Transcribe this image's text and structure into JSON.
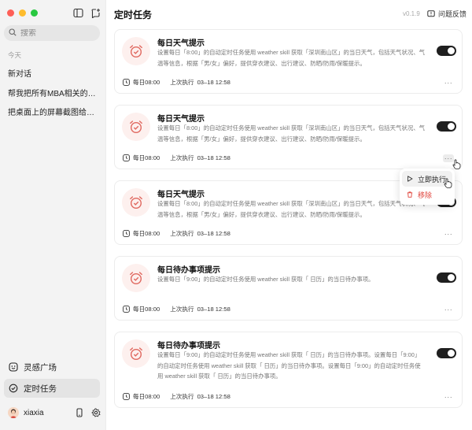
{
  "sidebar": {
    "search": {
      "placeholder": "搜索"
    },
    "section_today": "今天",
    "chats": [
      "新对话",
      "帮我把所有MBA相关的广告…",
      "把桌面上的屏幕截图给我整…"
    ],
    "nav": {
      "inspire": "灵感广场",
      "tasks": "定时任务"
    },
    "user": {
      "name": "xiaxia"
    }
  },
  "header": {
    "title": "定时任务",
    "version": "v0.1.9",
    "feedback": "问题反馈"
  },
  "tasks": [
    {
      "title": "每日天气提示",
      "desc": "设置每日「8:00」的自动定时任务使用 weather skill 获取「深圳南山区」的当日天气，包括天气状况、气温等信息，根据「男/女」偏好，提供穿衣建议、出行建议、防晒/防雨/保暖提示。",
      "schedule": "每日08:00",
      "last_run_label": "上次执行",
      "last_run": "03–18 12:58",
      "enabled": true
    },
    {
      "title": "每日天气提示",
      "desc": "设置每日「8:00」的自动定时任务使用 weather skill 获取「深圳南山区」的当日天气，包括天气状况、气温等信息，根据「男/女」偏好，提供穿衣建议、出行建议、防晒/防雨/保暖提示。",
      "schedule": "每日08:00",
      "last_run_label": "上次执行",
      "last_run": "03–18 12:58",
      "enabled": true
    },
    {
      "title": "每日天气提示",
      "desc": "设置每日「8:00」的自动定时任务使用 weather skill 获取「深圳南山区」的当日天气，包括天气状况、气温等信息，根据「男/女」偏好，提供穿衣建议、出行建议、防晒/防雨/保暖提示。",
      "schedule": "每日08:00",
      "last_run_label": "上次执行",
      "last_run": "03–18 12:58",
      "enabled": true
    },
    {
      "title": "每日待办事项提示",
      "desc": "设置每日「9:00」的自动定时任务使用 weather skill 获取「 日历」的当日待办事项。",
      "schedule": "每日08:00",
      "last_run_label": "上次执行",
      "last_run": "03–18 12:58",
      "enabled": true
    },
    {
      "title": "每日待办事项提示",
      "desc": "设置每日「9:00」的自动定时任务使用 weather skill 获取「 日历」的当日待办事项。设置每日「9:00」的自动定时任务使用 weather skill 获取「 日历」的当日待办事项。设置每日「9:00」的自动定时任务使用 weather skill 获取「 日历」的当日待办事项。",
      "schedule": "每日08:00",
      "last_run_label": "上次执行",
      "last_run": "03–18 12:58",
      "enabled": true
    }
  ],
  "more_label": "···",
  "popup": {
    "run_now": "立即执行",
    "remove": "移除"
  },
  "colors": {
    "accent_red": "#e0433b",
    "toggle_on": "#1f1f1f",
    "icon_bg": "#fdf0ee"
  }
}
